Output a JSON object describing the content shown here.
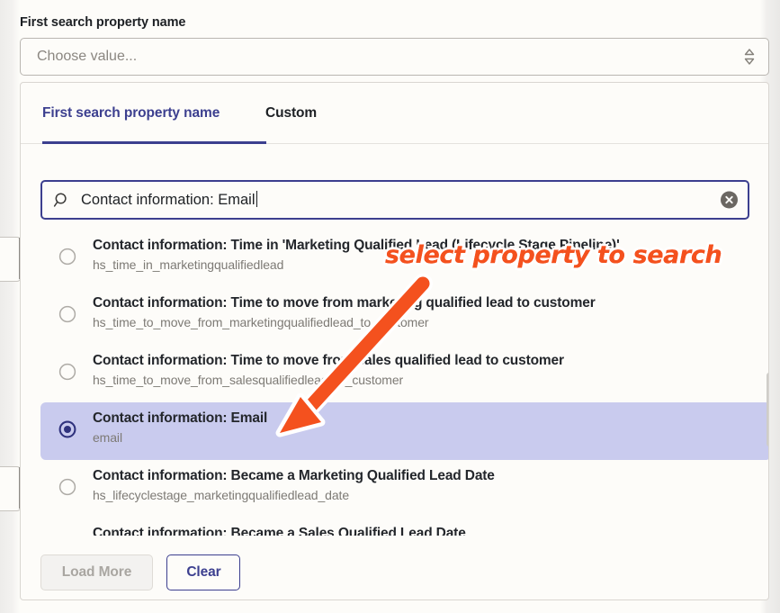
{
  "field": {
    "label": "First search property name",
    "placeholder": "Choose value...",
    "stepper_icon": "chevron-up-down-icon"
  },
  "panel": {
    "tabs": [
      {
        "label": "First search property name",
        "active": true
      },
      {
        "label": "Custom",
        "active": false
      }
    ],
    "search": {
      "icon": "search-icon",
      "value": "Contact information: Email",
      "clear_icon": "clear-circle-icon"
    },
    "options": [
      {
        "title": "Contact information: Time in 'Marketing Qualified Lead (Lifecycle Stage Pipeline)'",
        "subtitle": "hs_time_in_marketingqualifiedlead",
        "selected": false
      },
      {
        "title": "Contact information: Time to move from marketing qualified lead to customer",
        "subtitle": "hs_time_to_move_from_marketingqualifiedlead_to_customer",
        "selected": false
      },
      {
        "title": "Contact information: Time to move from sales qualified lead to customer",
        "subtitle": "hs_time_to_move_from_salesqualifiedlead_to_customer",
        "selected": false
      },
      {
        "title": "Contact information: Email",
        "subtitle": "email",
        "selected": true
      },
      {
        "title": "Contact information: Became a Marketing Qualified Lead Date",
        "subtitle": "hs_lifecyclestage_marketingqualifiedlead_date",
        "selected": false
      },
      {
        "title": "Contact information: Became a Sales Qualified Lead Date",
        "subtitle": "",
        "selected": false
      }
    ],
    "footer": {
      "load_more_label": "Load More",
      "clear_label": "Clear"
    }
  },
  "annotation": {
    "text": "select property to search",
    "color": "#f4511e",
    "outline_color": "#ffffff",
    "arrow": "arrow-pointing-down-left"
  },
  "colors": {
    "accent": "#3c3f8f",
    "selected_row_bg": "#c9cbee",
    "panel_bg": "#fdfcf9",
    "page_bg": "#f1f0ee",
    "text_primary": "#23262b",
    "text_muted": "#7d7a75"
  }
}
